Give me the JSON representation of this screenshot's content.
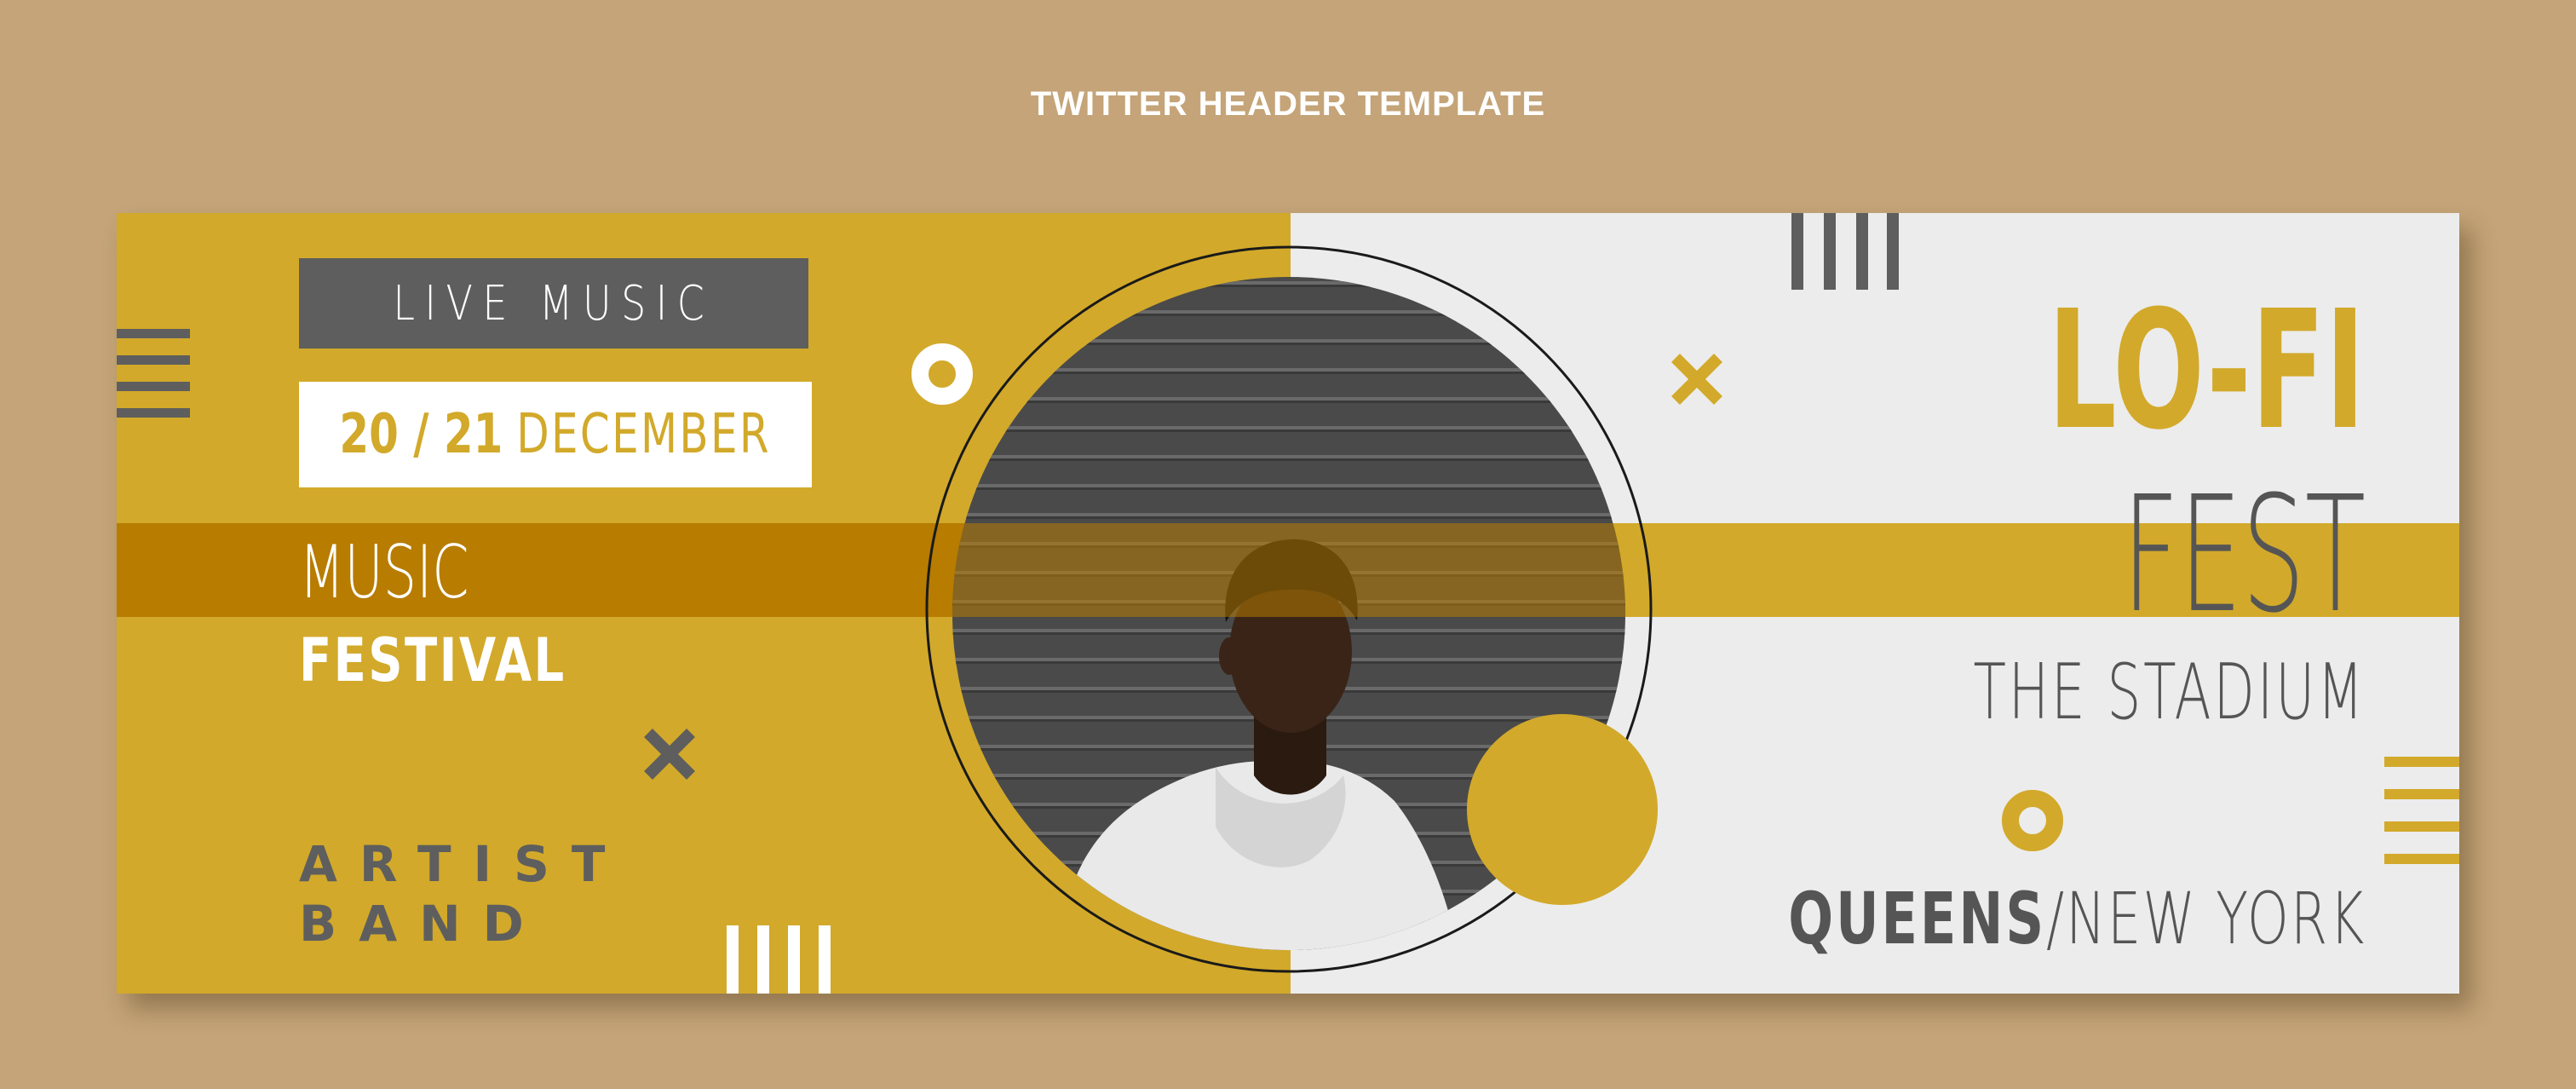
{
  "page": {
    "title": "TWITTER HEADER TEMPLATE"
  },
  "banner": {
    "left": {
      "live_label": "LIVE MUSIC",
      "date": {
        "days": "20 / 21",
        "month": "DECEMBER"
      },
      "music": "MUSIC",
      "festival": "FESTIVAL",
      "artist": "ARTIST",
      "band": "BAND"
    },
    "right": {
      "lofi": "LO-FI",
      "fest": "FEST",
      "venue": "THE STADIUM",
      "location": {
        "city": "QUEENS",
        "separator": "/",
        "region": "NEW YORK"
      }
    },
    "photo": {
      "subject": "person-in-white-hoodie-photo"
    },
    "colors": {
      "background": "#c4a478",
      "mustard": "#d2a92a",
      "dark_mustard": "#b77c00",
      "light_gray": "#ececec",
      "charcoal": "#5e5e5e",
      "white": "#ffffff"
    },
    "icons": [
      "ring-icon",
      "cross-icon",
      "stripes-icon"
    ]
  }
}
